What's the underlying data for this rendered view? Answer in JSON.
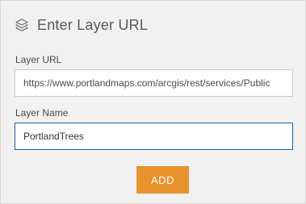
{
  "header": {
    "icon": "layers-icon",
    "title": "Enter Layer URL"
  },
  "fields": {
    "url": {
      "label": "Layer URL",
      "value": "https://www.portlandmaps.com/arcgis/rest/services/Public"
    },
    "name": {
      "label": "Layer Name",
      "value": "PortlandTrees"
    }
  },
  "actions": {
    "add_label": "ADD"
  },
  "colors": {
    "panel_background": "#f1f1f1",
    "accent_button": "#e8922d",
    "focus_border": "#1f5f9e",
    "text": "#5a5a5a"
  }
}
